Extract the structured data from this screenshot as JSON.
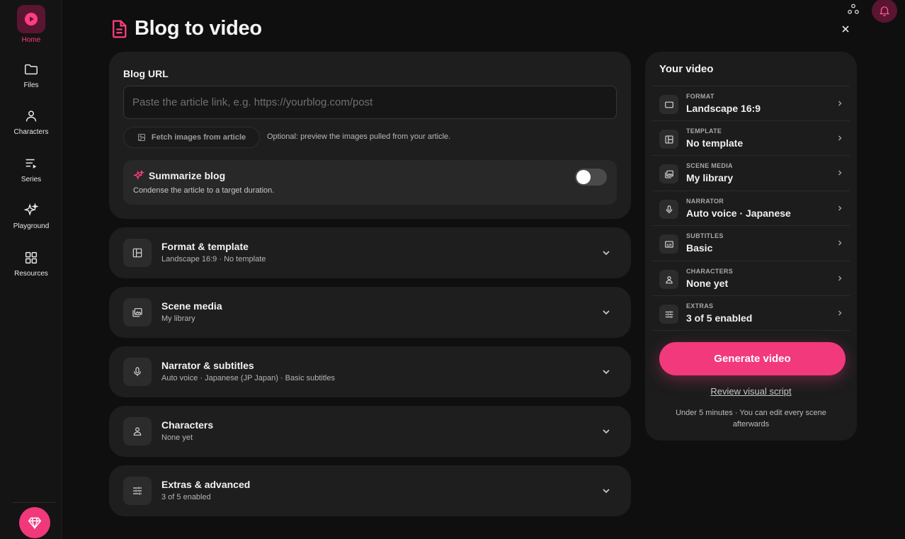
{
  "sidebar": {
    "items": [
      {
        "label": "Home"
      },
      {
        "label": "Files"
      },
      {
        "label": "Characters"
      },
      {
        "label": "Series"
      },
      {
        "label": "Playground"
      },
      {
        "label": "Resources"
      }
    ]
  },
  "header": {
    "title": "Blog to video"
  },
  "blog": {
    "url_label": "Blog URL",
    "url_value": "",
    "url_placeholder": "Paste the article link, e.g. https://yourblog.com/post",
    "fetch_label": "Fetch images from article",
    "fetch_hint": "Optional: preview the images pulled from your article.",
    "summarize_title": "Summarize blog",
    "summarize_desc": "Condense the article to a target duration.",
    "summarize_enabled": false
  },
  "sections": [
    {
      "title": "Format & template",
      "subtitle": "Landscape 16:9 · No template",
      "icon": "layout-icon"
    },
    {
      "title": "Scene media",
      "subtitle": "My library",
      "icon": "media-library-icon"
    },
    {
      "title": "Narrator & subtitles",
      "subtitle": "Auto voice · Japanese (JP Japan) · Basic subtitles",
      "icon": "microphone-icon"
    },
    {
      "title": "Characters",
      "subtitle": "None yet",
      "icon": "person-icon"
    },
    {
      "title": "Extras & advanced",
      "subtitle": "3 of 5 enabled",
      "icon": "sliders-icon"
    }
  ],
  "summary": {
    "title": "Your video",
    "rows": [
      {
        "label": "FORMAT",
        "value": "Landscape 16:9",
        "icon": "rectangle-icon"
      },
      {
        "label": "TEMPLATE",
        "value": "No template",
        "icon": "layout-icon"
      },
      {
        "label": "SCENE MEDIA",
        "value": "My library",
        "icon": "media-library-icon"
      },
      {
        "label": "NARRATOR",
        "value": "Auto voice · Japanese",
        "icon": "microphone-icon"
      },
      {
        "label": "SUBTITLES",
        "value": "Basic",
        "icon": "subtitles-icon"
      },
      {
        "label": "CHARACTERS",
        "value": "None yet",
        "icon": "person-icon"
      },
      {
        "label": "EXTRAS",
        "value": "3 of 5 enabled",
        "icon": "sliders-icon"
      }
    ],
    "generate_label": "Generate video",
    "review_label": "Review visual script",
    "note": "Under 5 minutes · You can edit every scene afterwards"
  },
  "colors": {
    "accent": "#f2397c",
    "background": "#0f0f0f",
    "card": "#1e1e1e"
  }
}
